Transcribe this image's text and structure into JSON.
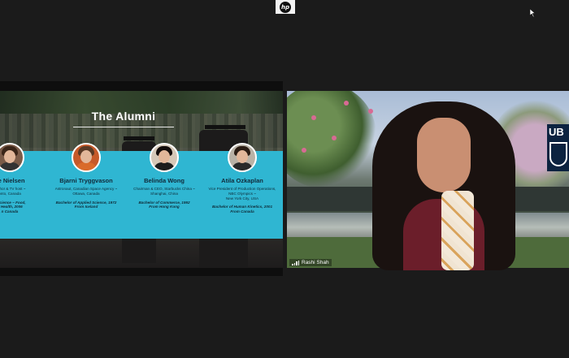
{
  "toolbar": {
    "logo_text": "hp"
  },
  "slide": {
    "title": "The Alumni",
    "alumni": [
      {
        "name": "ee Nielsen",
        "role": "Author & TV host ~\nonto, Canada",
        "degree": "d Science ~ Food,\n& Health, 2006\nn Canada"
      },
      {
        "name": "Bjarni Tryggvason",
        "role": "Astronaut, Canadian Space Agency ~\nOttawa, Canada",
        "degree": "Bachelor of Applied Science, 1972\nFrom Iceland"
      },
      {
        "name": "Belinda Wong",
        "role": "Chairman & CEO, Starbucks China ~\nShanghai, China",
        "degree": "Bachelor of Commerce, 1992\nFrom Hong Kong"
      },
      {
        "name": "Atila Ozkaplan",
        "role": "Vice President of Production Operations,\nNBC Olympics ~\nNew York City, USA",
        "degree": "Bachelor of Human Kinetics, 2001\nFrom Canada"
      }
    ]
  },
  "video": {
    "participant_name": "Rashi Shah",
    "logo_text": "UB"
  },
  "colors": {
    "band": "#2fb6d2",
    "background": "#1b1b1b"
  }
}
